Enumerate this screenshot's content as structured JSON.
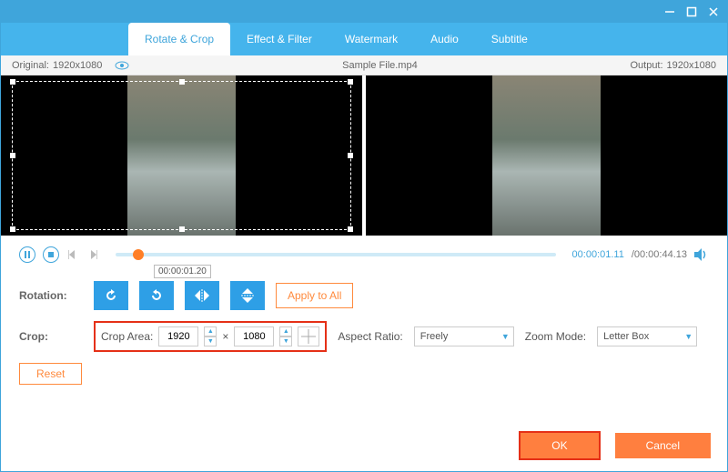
{
  "titlebar": {
    "minimize": "–",
    "maximize": "☐",
    "close": "✕"
  },
  "tabs": [
    {
      "label": "Rotate & Crop",
      "active": true
    },
    {
      "label": "Effect & Filter",
      "active": false
    },
    {
      "label": "Watermark",
      "active": false
    },
    {
      "label": "Audio",
      "active": false
    },
    {
      "label": "Subtitle",
      "active": false
    }
  ],
  "info": {
    "original_label": "Original:",
    "original_res": "1920x1080",
    "filename": "Sample File.mp4",
    "output_label": "Output:",
    "output_res": "1920x1080"
  },
  "playback": {
    "tooltip_time": "00:00:01.20",
    "current": "00:00:01.11",
    "total": "/00:00:44.13"
  },
  "rotation": {
    "label": "Rotation:",
    "apply_all": "Apply to All"
  },
  "crop": {
    "label": "Crop:",
    "area_label": "Crop Area:",
    "width": "1920",
    "x": "×",
    "height": "1080",
    "aspect_label": "Aspect Ratio:",
    "aspect_value": "Freely",
    "zoom_label": "Zoom Mode:",
    "zoom_value": "Letter Box",
    "reset": "Reset"
  },
  "footer": {
    "ok": "OK",
    "cancel": "Cancel"
  }
}
